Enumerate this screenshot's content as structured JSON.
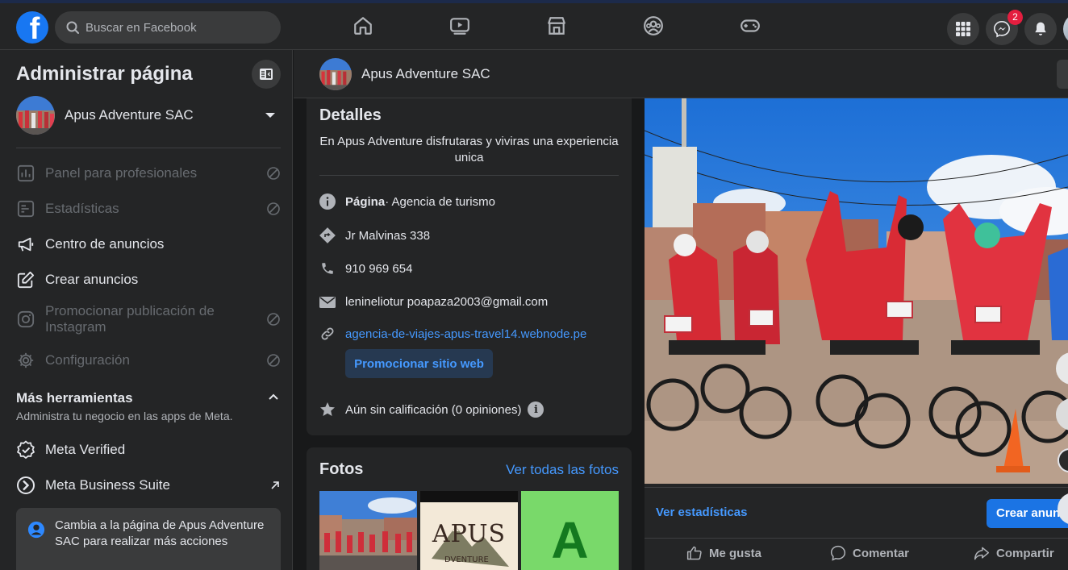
{
  "topbar": {
    "logo": "f",
    "search_placeholder": "Buscar en Facebook",
    "nav_icons": [
      "home-icon",
      "video-icon",
      "marketplace-icon",
      "groups-icon",
      "gaming-icon"
    ],
    "messenger_badge": "2"
  },
  "sidebar": {
    "title": "Administrar página",
    "page_name": "Apus Adventure SAC",
    "items": [
      {
        "label": "Panel para profesionales",
        "icon": "dashboard-icon",
        "disabled": true
      },
      {
        "label": "Estadísticas",
        "icon": "insights-icon",
        "disabled": true
      },
      {
        "label": "Centro de anuncios",
        "icon": "megaphone-icon",
        "disabled": false
      },
      {
        "label": "Crear anuncios",
        "icon": "edit-icon",
        "disabled": false
      },
      {
        "label": "Promocionar publicación de Instagram",
        "icon": "instagram-icon",
        "disabled": true
      },
      {
        "label": "Configuración",
        "icon": "gear-icon",
        "disabled": true
      }
    ],
    "tools_title": "Más herramientas",
    "tools_subtitle": "Administra tu negocio en las apps de Meta.",
    "tools": [
      {
        "label": "Meta Verified",
        "icon": "verified-icon"
      },
      {
        "label": "Meta Business Suite",
        "icon": "business-suite-icon"
      }
    ],
    "switch_card": "Cambia a la página de Apus Adventure SAC para realizar más acciones"
  },
  "page_header": {
    "name": "Apus Adventure SAC"
  },
  "details": {
    "title": "Detalles",
    "about": "En Apus Adventure disfrutaras y viviras una experiencia unica",
    "category_label": "Página",
    "category_value": " · Agencia de turismo",
    "address": "Jr Malvinas 338",
    "phone": "910 969 654",
    "email": "lenineliotur poapaza2003@gmail.com",
    "website": "agencia-de-viajes-apus-travel14.webnode.pe",
    "promote_button": "Promocionar sitio web",
    "rating": "Aún sin calificación (0 opiniones)"
  },
  "photos": {
    "title": "Fotos",
    "see_all": "Ver todas las fotos",
    "thumb2_text": "APUS",
    "thumb2_sub": "DVENTURE",
    "thumb3_text": "A"
  },
  "post": {
    "stats_link": "Ver estadísticas",
    "create_ad_button": "Crear anun",
    "actions": [
      "Me gusta",
      "Comentar",
      "Compartir"
    ]
  },
  "colors": {
    "background": "#18191a",
    "surface": "#242526",
    "accent": "#1877f2",
    "link": "#4599ff"
  }
}
